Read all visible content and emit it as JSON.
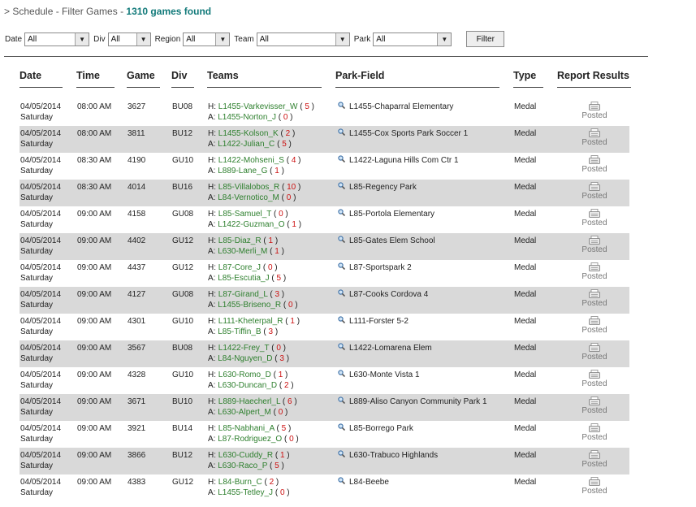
{
  "header": {
    "breadcrumb": "> Schedule - Filter Games",
    "separator": " - ",
    "games_found": "1310 games found"
  },
  "filters": [
    {
      "label": "Date",
      "value": "All"
    },
    {
      "label": "Div",
      "value": "All"
    },
    {
      "label": "Region",
      "value": "All"
    },
    {
      "label": "Team",
      "value": "All"
    },
    {
      "label": "Park",
      "value": "All"
    }
  ],
  "filter_button": "Filter",
  "columns": [
    "Date",
    "Time",
    "Game",
    "Div",
    "Teams",
    "Park-Field",
    "Type",
    "Report Results"
  ],
  "home_prefix": "H: ",
  "away_prefix": "A: ",
  "games": [
    {
      "date": "04/05/2014",
      "day": "Saturday",
      "time": "08:00 AM",
      "game": "3627",
      "div": "BU08",
      "home": "L1455-Varkevisser_W",
      "home_score": "5",
      "away": "L1455-Norton_J",
      "away_score": "0",
      "field": "L1455-Chaparral Elementary",
      "type": "Medal",
      "result": "Posted"
    },
    {
      "date": "04/05/2014",
      "day": "Saturday",
      "time": "08:00 AM",
      "game": "3811",
      "div": "BU12",
      "home": "L1455-Kolson_K",
      "home_score": "2",
      "away": "L1422-Julian_C",
      "away_score": "5",
      "field": "L1455-Cox Sports Park Soccer 1",
      "type": "Medal",
      "result": "Posted"
    },
    {
      "date": "04/05/2014",
      "day": "Saturday",
      "time": "08:30 AM",
      "game": "4190",
      "div": "GU10",
      "home": "L1422-Mohseni_S",
      "home_score": "4",
      "away": "L889-Lane_G",
      "away_score": "1",
      "field": "L1422-Laguna Hills Com Ctr 1",
      "type": "Medal",
      "result": "Posted"
    },
    {
      "date": "04/05/2014",
      "day": "Saturday",
      "time": "08:30 AM",
      "game": "4014",
      "div": "BU16",
      "home": "L85-Villalobos_R",
      "home_score": "10",
      "away": "L84-Vernotico_M",
      "away_score": "0",
      "field": "L85-Regency Park",
      "type": "Medal",
      "result": "Posted"
    },
    {
      "date": "04/05/2014",
      "day": "Saturday",
      "time": "09:00 AM",
      "game": "4158",
      "div": "GU08",
      "home": "L85-Samuel_T",
      "home_score": "0",
      "away": "L1422-Guzman_O",
      "away_score": "1",
      "field": "L85-Portola Elementary",
      "type": "Medal",
      "result": "Posted"
    },
    {
      "date": "04/05/2014",
      "day": "Saturday",
      "time": "09:00 AM",
      "game": "4402",
      "div": "GU12",
      "home": "L85-Diaz_R",
      "home_score": "1",
      "away": "L630-Merli_M",
      "away_score": "1",
      "field": "L85-Gates Elem School",
      "type": "Medal",
      "result": "Posted"
    },
    {
      "date": "04/05/2014",
      "day": "Saturday",
      "time": "09:00 AM",
      "game": "4437",
      "div": "GU12",
      "home": "L87-Core_J",
      "home_score": "0",
      "away": "L85-Escutia_J",
      "away_score": "5",
      "field": "L87-Sportspark 2",
      "type": "Medal",
      "result": "Posted"
    },
    {
      "date": "04/05/2014",
      "day": "Saturday",
      "time": "09:00 AM",
      "game": "4127",
      "div": "GU08",
      "home": "L87-Girand_L",
      "home_score": "3",
      "away": "L1455-Briseno_R",
      "away_score": "0",
      "field": "L87-Cooks Cordova 4",
      "type": "Medal",
      "result": "Posted"
    },
    {
      "date": "04/05/2014",
      "day": "Saturday",
      "time": "09:00 AM",
      "game": "4301",
      "div": "GU10",
      "home": "L111-Kheterpal_R",
      "home_score": "1",
      "away": "L85-Tiffin_B",
      "away_score": "3",
      "field": "L111-Forster 5-2",
      "type": "Medal",
      "result": "Posted"
    },
    {
      "date": "04/05/2014",
      "day": "Saturday",
      "time": "09:00 AM",
      "game": "3567",
      "div": "BU08",
      "home": "L1422-Frey_T",
      "home_score": "0",
      "away": "L84-Nguyen_D",
      "away_score": "3",
      "field": "L1422-Lomarena Elem",
      "type": "Medal",
      "result": "Posted"
    },
    {
      "date": "04/05/2014",
      "day": "Saturday",
      "time": "09:00 AM",
      "game": "4328",
      "div": "GU10",
      "home": "L630-Romo_D",
      "home_score": "1",
      "away": "L630-Duncan_D",
      "away_score": "2",
      "field": "L630-Monte Vista 1",
      "type": "Medal",
      "result": "Posted"
    },
    {
      "date": "04/05/2014",
      "day": "Saturday",
      "time": "09:00 AM",
      "game": "3671",
      "div": "BU10",
      "home": "L889-Haecherl_L",
      "home_score": "6",
      "away": "L630-Alpert_M",
      "away_score": "0",
      "field": "L889-Aliso Canyon Community Park 1",
      "type": "Medal",
      "result": "Posted"
    },
    {
      "date": "04/05/2014",
      "day": "Saturday",
      "time": "09:00 AM",
      "game": "3921",
      "div": "BU14",
      "home": "L85-Nabhani_A",
      "home_score": "5",
      "away": "L87-Rodriguez_O",
      "away_score": "0",
      "field": "L85-Borrego Park",
      "type": "Medal",
      "result": "Posted"
    },
    {
      "date": "04/05/2014",
      "day": "Saturday",
      "time": "09:00 AM",
      "game": "3866",
      "div": "BU12",
      "home": "L630-Cuddy_R",
      "home_score": "1",
      "away": "L630-Raco_P",
      "away_score": "5",
      "field": "L630-Trabuco Highlands",
      "type": "Medal",
      "result": "Posted"
    },
    {
      "date": "04/05/2014",
      "day": "Saturday",
      "time": "09:00 AM",
      "game": "4383",
      "div": "GU12",
      "home": "L84-Burn_C",
      "home_score": "2",
      "away": "L1455-Tetley_J",
      "away_score": "0",
      "field": "L84-Beebe",
      "type": "Medal",
      "result": "Posted"
    }
  ],
  "icons": {
    "field_lookup": "magnifier-icon",
    "report": "report-sheet-icon",
    "dropdown": "chevron-down-icon"
  },
  "colors": {
    "title_count": "#127a7a",
    "team_link": "#2d7f2d",
    "score": "#cc1111",
    "row_shade": "#d9d9d9"
  }
}
